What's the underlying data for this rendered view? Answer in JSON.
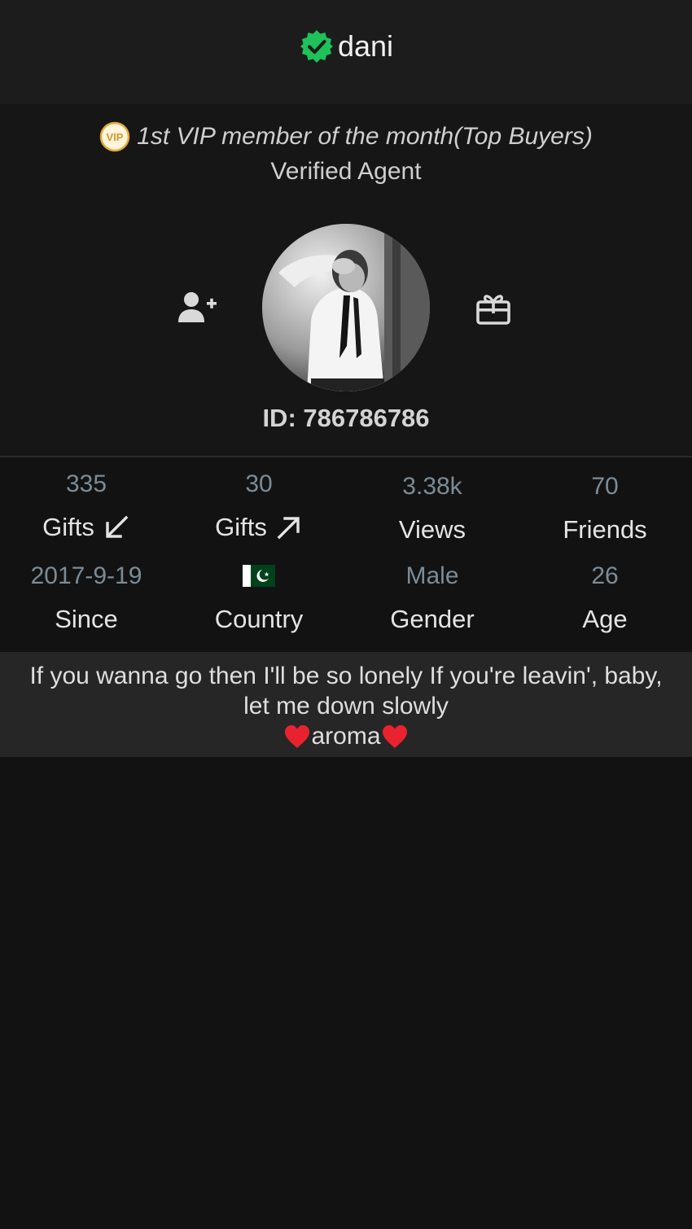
{
  "header": {
    "username": "dani",
    "verified_icon": "verified-badge-icon",
    "verified_color": "#1ec15a"
  },
  "profile": {
    "vip_badge_label": "VIP",
    "vip_title": "1st VIP member of the month(Top Buyers)",
    "agent_label": "Verified Agent",
    "id_text": "ID: 786786786",
    "add_friend_icon": "add-friend-icon",
    "gift_icon": "gift-icon",
    "avatar_icon": "profile-photo"
  },
  "stats": {
    "received_gifts": {
      "value": "335",
      "label": "Gifts",
      "icon": "arrow-down-left-icon"
    },
    "sent_gifts": {
      "value": "30",
      "label": "Gifts",
      "icon": "arrow-up-right-icon"
    },
    "views": {
      "value": "3.38k",
      "label": "Views"
    },
    "friends": {
      "value": "70",
      "label": "Friends"
    },
    "since": {
      "value": "2017-9-19",
      "label": "Since"
    },
    "country": {
      "flag_icon": "pakistan-flag-icon",
      "label": "Country"
    },
    "gender": {
      "value": "Male",
      "label": "Gender"
    },
    "age": {
      "value": "26",
      "label": "Age"
    }
  },
  "bio": {
    "line1": "If you wanna go then I'll be so lonely If you're leavin', baby,",
    "line2": "let me down slowly",
    "line3": "aroma",
    "heart_icon": "red-heart-icon"
  },
  "colors": {
    "background": "#121212",
    "topbar": "#1c1c1c",
    "stat_value": "#7c8b96",
    "bio_background": "#262626"
  }
}
